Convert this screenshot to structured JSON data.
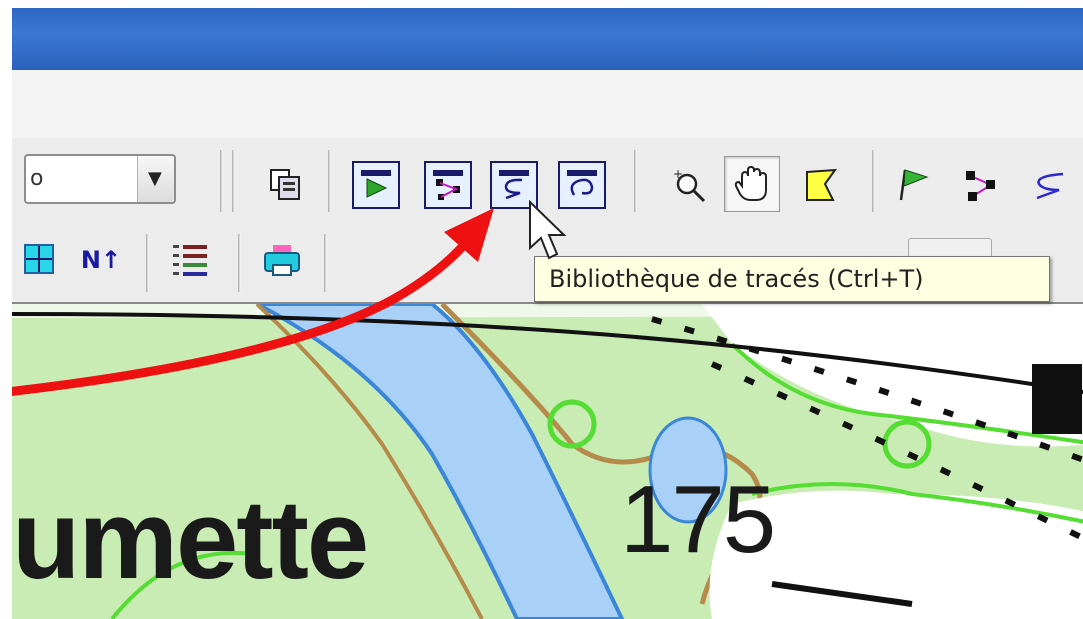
{
  "toolbar": {
    "combo_value": "o",
    "buttons": [
      {
        "icon": "copy-layers-icon"
      },
      {
        "icon": "waypoint-library-icon"
      },
      {
        "icon": "route-library-icon"
      },
      {
        "icon": "track-library-icon"
      },
      {
        "icon": "area-library-icon"
      },
      {
        "icon": "zoom-tool-icon"
      },
      {
        "icon": "hand-pan-icon"
      },
      {
        "icon": "area-select-icon"
      },
      {
        "icon": "waypoint-flag-icon"
      },
      {
        "icon": "route-tool-icon"
      },
      {
        "icon": "track-tool-icon"
      }
    ]
  },
  "toolbar2": {
    "north_label": "N↑"
  },
  "tooltip": {
    "text": "Bibliothèque de tracés (Ctrl+T)"
  },
  "map": {
    "place_label": "umette",
    "elevation_label": "175"
  },
  "colors": {
    "title_bar": "#2e66c4",
    "annotation_arrow": "#ee1111",
    "map_vegetation": "#c9ecb4",
    "map_water": "#a9d0f7",
    "map_road": "#b58a4a"
  }
}
